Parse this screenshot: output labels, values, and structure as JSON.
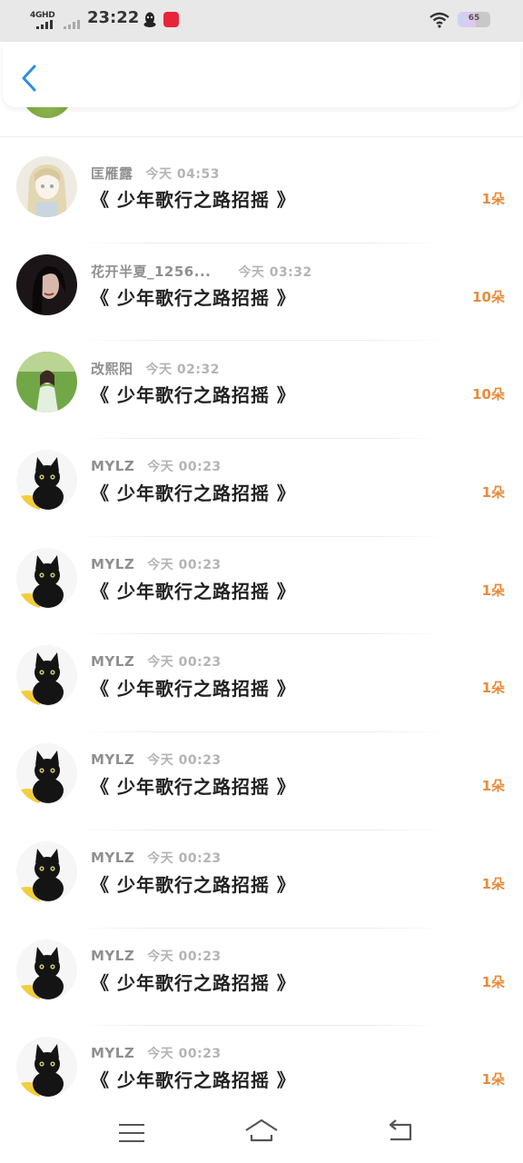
{
  "status_bar": {
    "network": "4GHD",
    "time": "23:22",
    "battery": "65"
  },
  "header": {
    "back_icon": "chevron-left-icon"
  },
  "list": [
    {
      "name": "匡雁露",
      "time": "今天 04:53",
      "title": "《 少年歌行之路招摇 》",
      "count": "1朵",
      "avatar": "anime-girl"
    },
    {
      "name": "花开半夏_1256...",
      "time": "今天 03:32",
      "title": "《 少年歌行之路招摇 》",
      "count": "10朵",
      "avatar": "dark-hair-girl"
    },
    {
      "name": "改熙阳",
      "time": "今天 02:32",
      "title": "《 少年歌行之路招摇 》",
      "count": "10朵",
      "avatar": "field-girl"
    },
    {
      "name": "MYLZ",
      "time": "今天 00:23",
      "title": "《 少年歌行之路招摇 》",
      "count": "1朵",
      "avatar": "black-cat"
    },
    {
      "name": "MYLZ",
      "time": "今天 00:23",
      "title": "《 少年歌行之路招摇 》",
      "count": "1朵",
      "avatar": "black-cat"
    },
    {
      "name": "MYLZ",
      "time": "今天 00:23",
      "title": "《 少年歌行之路招摇 》",
      "count": "1朵",
      "avatar": "black-cat"
    },
    {
      "name": "MYLZ",
      "time": "今天 00:23",
      "title": "《 少年歌行之路招摇 》",
      "count": "1朵",
      "avatar": "black-cat"
    },
    {
      "name": "MYLZ",
      "time": "今天 00:23",
      "title": "《 少年歌行之路招摇 》",
      "count": "1朵",
      "avatar": "black-cat"
    },
    {
      "name": "MYLZ",
      "time": "今天 00:23",
      "title": "《 少年歌行之路招摇 》",
      "count": "1朵",
      "avatar": "black-cat"
    },
    {
      "name": "MYLZ",
      "time": "今天 00:23",
      "title": "《 少年歌行之路招摇 》",
      "count": "1朵",
      "avatar": "black-cat"
    }
  ],
  "colors": {
    "accent_blue": "#2d8ee0",
    "count_orange": "#ea8a3b",
    "name_gray": "#8f8f8f",
    "time_gray": "#b4b4b4"
  },
  "nav_bar": {
    "icons": [
      "menu-icon",
      "home-icon",
      "back-icon"
    ]
  }
}
